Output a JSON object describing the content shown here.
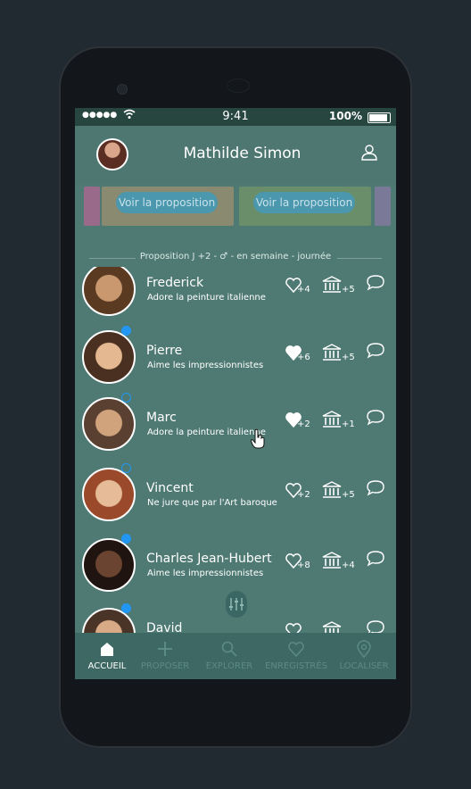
{
  "status_bar": {
    "signal_dots": "●●●●●",
    "time": "9:41",
    "battery": "100%"
  },
  "header": {
    "title": "Mathilde Simon",
    "avatar_icon": "user-avatar",
    "profile_icon": "user-outline-icon"
  },
  "proposals": {
    "left_button": "Voir la proposition",
    "right_button": "Voir la proposition"
  },
  "section_label": "Proposition J +2 - ♂ - en semaine - journée",
  "people": [
    {
      "name": "Frederick",
      "desc": "Adore la peinture italienne",
      "likes": "+4",
      "museums": "+5",
      "liked": false,
      "status": "none"
    },
    {
      "name": "Pierre",
      "desc": "Aime les impressionnistes",
      "likes": "+6",
      "museums": "+5",
      "liked": true,
      "status": "online"
    },
    {
      "name": "Marc",
      "desc": "Adore la peinture italienne",
      "likes": "+2",
      "museums": "+1",
      "liked": true,
      "status": "away"
    },
    {
      "name": "Vincent",
      "desc": "Ne jure que par l'Art baroque",
      "likes": "+2",
      "museums": "+5",
      "liked": false,
      "status": "away"
    },
    {
      "name": "Charles Jean-Hubert",
      "desc": "Aime les impressionnistes",
      "likes": "+8",
      "museums": "+4",
      "liked": false,
      "status": "online"
    },
    {
      "name": "David",
      "desc": "",
      "likes": "",
      "museums": "",
      "liked": false,
      "status": "online"
    }
  ],
  "tabs": [
    {
      "label": "ACCUEIL",
      "icon": "home-icon",
      "active": true
    },
    {
      "label": "PROPOSER",
      "icon": "plus-icon",
      "active": false
    },
    {
      "label": "EXPLORER",
      "icon": "search-icon",
      "active": false
    },
    {
      "label": "ENREGISTRÉS",
      "icon": "heart-icon",
      "active": false
    },
    {
      "label": "LOCALISER",
      "icon": "location-pin-icon",
      "active": false
    }
  ],
  "colors": {
    "screen_bg": "#4f7a73",
    "online": "#2196f3",
    "accent_button": "#4b97ad"
  }
}
